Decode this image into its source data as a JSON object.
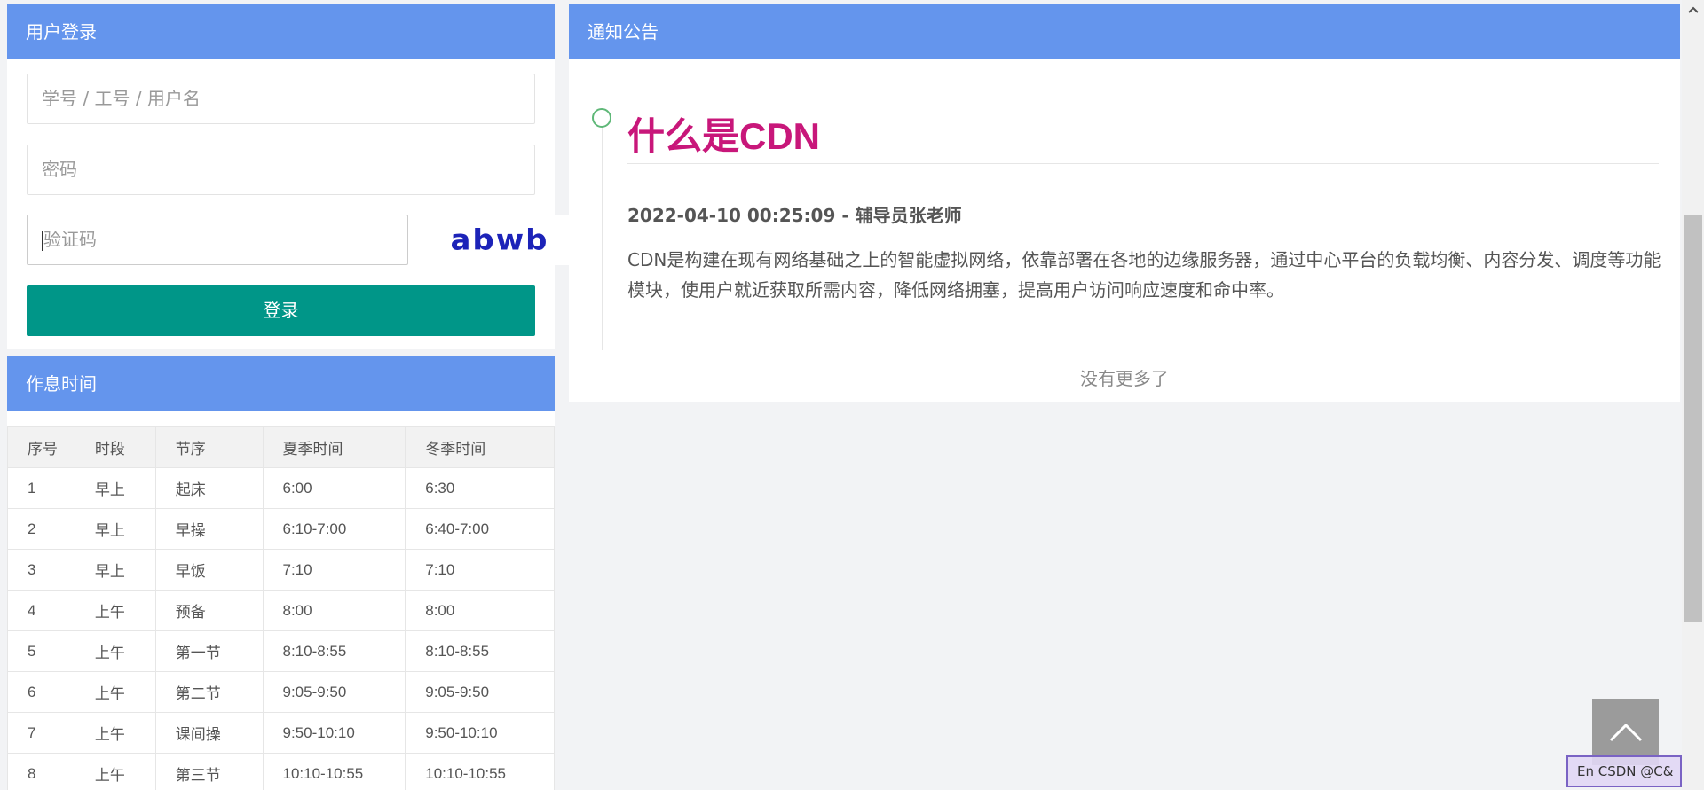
{
  "login": {
    "title": "用户登录",
    "username_placeholder": "学号 / 工号 / 用户名",
    "password_placeholder": "密码",
    "captcha_placeholder": "验证码",
    "captcha_text": "abwb",
    "login_button": "登录"
  },
  "schedule": {
    "title": "作息时间",
    "headers": [
      "序号",
      "时段",
      "节序",
      "夏季时间",
      "冬季时间"
    ],
    "rows": [
      [
        "1",
        "早上",
        "起床",
        "6:00",
        "6:30"
      ],
      [
        "2",
        "早上",
        "早操",
        "6:10-7:00",
        "6:40-7:00"
      ],
      [
        "3",
        "早上",
        "早饭",
        "7:10",
        "7:10"
      ],
      [
        "4",
        "上午",
        "预备",
        "8:00",
        "8:00"
      ],
      [
        "5",
        "上午",
        "第一节",
        "8:10-8:55",
        "8:10-8:55"
      ],
      [
        "6",
        "上午",
        "第二节",
        "9:05-9:50",
        "9:05-9:50"
      ],
      [
        "7",
        "上午",
        "课间操",
        "9:50-10:10",
        "9:50-10:10"
      ],
      [
        "8",
        "上午",
        "第三节",
        "10:10-10:55",
        "10:10-10:55"
      ]
    ]
  },
  "notice": {
    "title": "通知公告",
    "item": {
      "headline": "什么是CDN",
      "date": "2022-04-10 00:25:09",
      "separator": " - ",
      "author": "辅导员张老师",
      "body": "CDN是构建在现有网络基础之上的智能虚拟网络，依靠部署在各地的边缘服务器，通过中心平台的负载均衡、内容分发、调度等功能模块，使用户就近获取所需内容，降低网络拥塞，提高用户访问响应速度和命中率。"
    },
    "no_more": "没有更多了"
  },
  "watermark": "En CSDN @C&"
}
